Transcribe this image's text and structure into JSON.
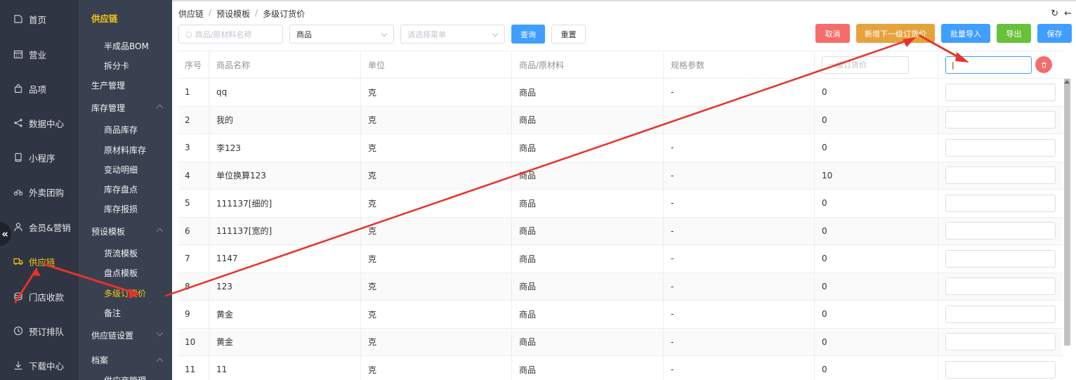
{
  "rail": {
    "items": [
      {
        "label": "首页",
        "icon": "home-icon"
      },
      {
        "label": "营业",
        "icon": "calendar-icon"
      },
      {
        "label": "品项",
        "icon": "bag-icon"
      },
      {
        "label": "数据中心",
        "icon": "share-icon"
      },
      {
        "label": "小程序",
        "icon": "phone-icon"
      },
      {
        "label": "外卖团购",
        "icon": "bike-icon"
      },
      {
        "label": "会员&营销",
        "icon": "user-icon"
      },
      {
        "label": "供应链",
        "icon": "truck-icon"
      },
      {
        "label": "门店收款",
        "icon": "coin-icon"
      },
      {
        "label": "预订排队",
        "icon": "clock-icon"
      },
      {
        "label": "下载中心",
        "icon": "download-icon"
      }
    ],
    "active": "供应链",
    "collapse_glyph": "«"
  },
  "submenu": {
    "title": "供应链",
    "items": {
      "bom": "半成品BOM",
      "split_card": "拆分卡",
      "production": "生产管理",
      "inventory": "库存管理",
      "goods_stock": "商品库存",
      "material_stock": "原材料库存",
      "change_detail": "变动明细",
      "stocktake": "库存盘点",
      "loss": "库存报损",
      "preset": "预设模板",
      "flow_template": "货流模板",
      "check_template": "盘点模板",
      "multi_price": "多级订货价",
      "remark": "备注",
      "settings": "供应链设置",
      "archive": "档案",
      "supplier": "供应商管理"
    }
  },
  "breadcrumb": [
    "供应链",
    "预设模板",
    "多级订货价"
  ],
  "breadcrumb_sep": "/",
  "top_icons": {
    "refresh": "↻",
    "back": "←"
  },
  "toolbar": {
    "search_placeholder": "商品/原材料名称",
    "type_value": "商品",
    "menu_placeholder": "请选择菜单",
    "query": "查询",
    "reset": "重置"
  },
  "actions": {
    "cancel": "取消",
    "add_level": "新增下一级订货价",
    "batch_import": "批量导入",
    "export": "导出",
    "save": "保存"
  },
  "table": {
    "headers": [
      "序号",
      "商品名称",
      "单位",
      "商品/原材料",
      "规格参数"
    ],
    "price_level_1": "一级订货价",
    "price_level_2_value": "|",
    "rows": [
      {
        "no": "1",
        "name": "qq",
        "unit": "克",
        "type": "商品",
        "spec": "-",
        "price": "0"
      },
      {
        "no": "2",
        "name": "我的",
        "unit": "克",
        "type": "商品",
        "spec": "",
        "price": "0"
      },
      {
        "no": "3",
        "name": "李123",
        "unit": "克",
        "type": "商品",
        "spec": "-",
        "price": "0"
      },
      {
        "no": "4",
        "name": "单位换算123",
        "unit": "克",
        "type": "商品",
        "spec": "-",
        "price": "10"
      },
      {
        "no": "5",
        "name": "111137[细的]",
        "unit": "克",
        "type": "商品",
        "spec": "-",
        "price": "0"
      },
      {
        "no": "6",
        "name": "111137[宽的]",
        "unit": "克",
        "type": "商品",
        "spec": "-",
        "price": "0"
      },
      {
        "no": "7",
        "name": "1147",
        "unit": "克",
        "type": "商品",
        "spec": "-",
        "price": "0"
      },
      {
        "no": "8",
        "name": "123",
        "unit": "克",
        "type": "商品",
        "spec": "-",
        "price": "0"
      },
      {
        "no": "9",
        "name": "黄金",
        "unit": "克",
        "type": "商品",
        "spec": "-",
        "price": "0"
      },
      {
        "no": "10",
        "name": "黄金",
        "unit": "克",
        "type": "商品",
        "spec": "-",
        "price": "0"
      },
      {
        "no": "11",
        "name": "11",
        "unit": "克",
        "type": "商品",
        "spec": "-",
        "price": "0"
      }
    ]
  },
  "colors": {
    "rail_bg": "#2f3542",
    "submenu_bg": "#394150",
    "accent_yellow": "#f5c518",
    "primary": "#409eff",
    "danger": "#f56c6c",
    "warning": "#e6a23c",
    "success": "#67c23a",
    "annotation_arrow": "#e8322b"
  }
}
